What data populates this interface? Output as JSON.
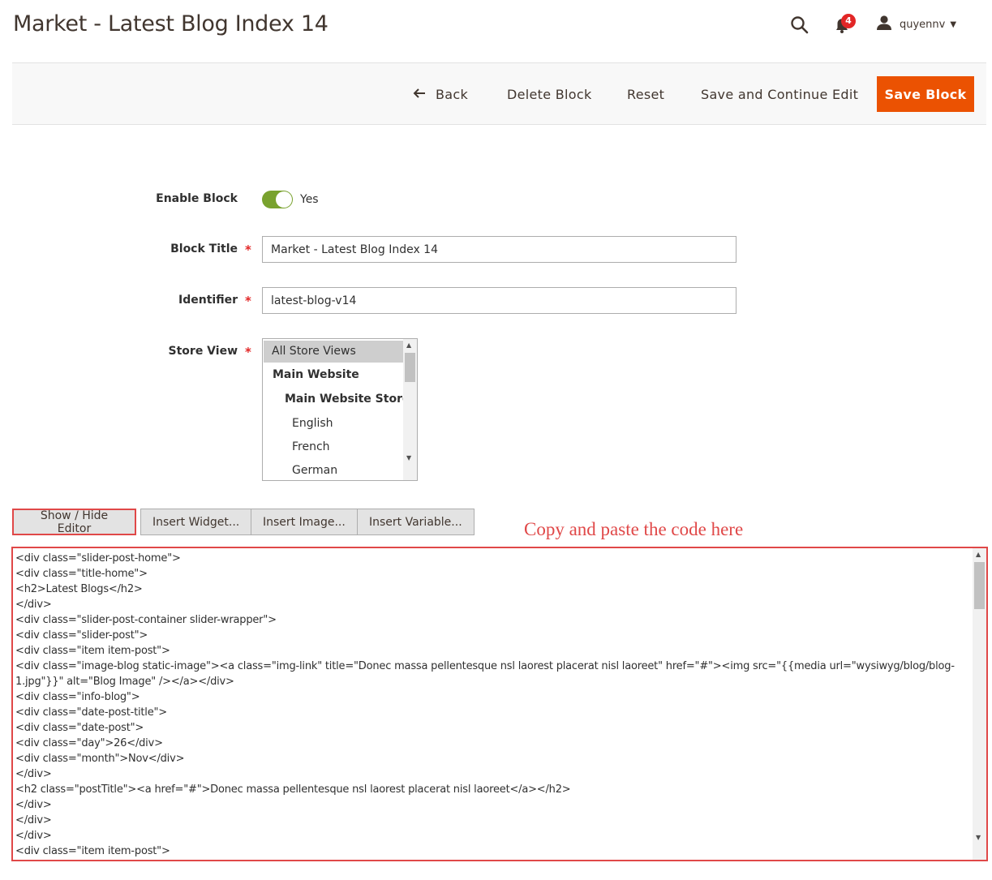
{
  "header": {
    "title": "Market - Latest Blog Index 14",
    "notification_count": "4",
    "username": "quyennv",
    "icons": [
      "search-icon",
      "bell-icon",
      "user-icon"
    ]
  },
  "actions": {
    "back": "Back",
    "delete": "Delete Block",
    "reset": "Reset",
    "save_continue": "Save and Continue Edit",
    "save": "Save Block"
  },
  "form": {
    "enable_label": "Enable Block",
    "enable_value": "Yes",
    "enabled": true,
    "title_label": "Block Title",
    "title_value": "Market - Latest Blog Index 14",
    "identifier_label": "Identifier",
    "identifier_value": "latest-blog-v14",
    "store_label": "Store View",
    "store_options": [
      "All Store Views",
      "Main Website",
      "Main Website Store",
      "English",
      "French",
      "German"
    ],
    "store_selected": "All Store Views"
  },
  "editor": {
    "show_hide": "Show / Hide Editor",
    "insert_widget": "Insert Widget...",
    "insert_image": "Insert Image...",
    "insert_variable": "Insert Variable...",
    "annotation": "Copy and paste the code here",
    "code_lines": [
      "<div class=\"slider-post-home\">",
      "<div class=\"title-home\">",
      "<h2>Latest Blogs</h2>",
      "</div>",
      "<div class=\"slider-post-container slider-wrapper\">",
      "<div class=\"slider-post\">",
      "<div class=\"item item-post\">",
      "<div class=\"image-blog static-image\"><a class=\"img-link\" title=\"Donec massa pellentesque nsl laorest placerat nisl laoreet\" href=\"#\"><img src=\"{{media url=\"wysiwyg/blog/blog-",
      "1.jpg\"}}\" alt=\"Blog Image\" /></a></div>",
      "<div class=\"info-blog\">",
      "<div class=\"date-post-title\">",
      "<div class=\"date-post\">",
      "<div class=\"day\">26</div>",
      "<div class=\"month\">Nov</div>",
      "</div>",
      "<h2 class=\"postTitle\"><a href=\"#\">Donec massa pellentesque nsl laorest placerat nisl laoreet</a></h2>",
      "</div>",
      "</div>",
      "</div>",
      "<div class=\"item item-post\">"
    ]
  }
}
